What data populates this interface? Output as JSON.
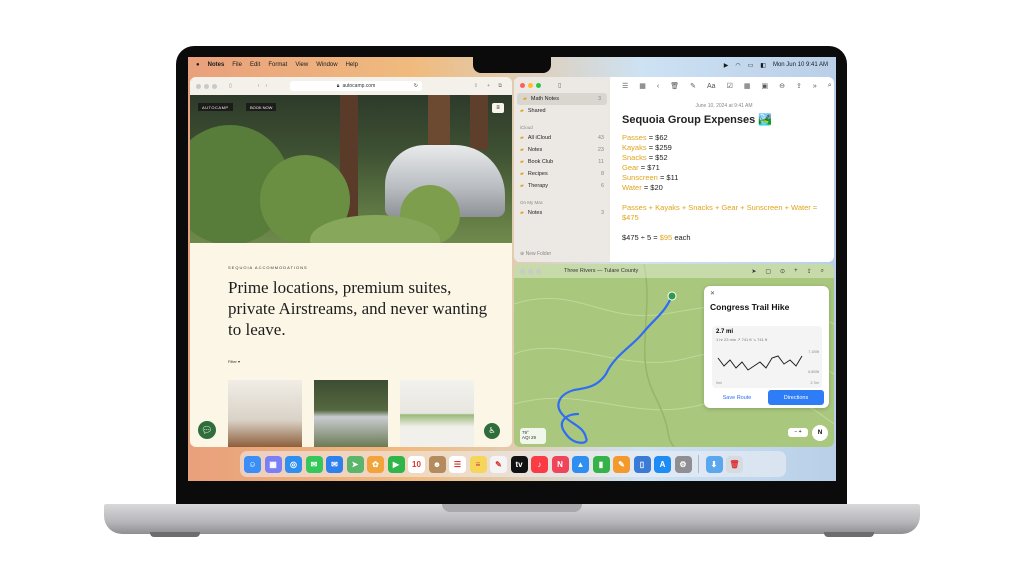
{
  "menubar": {
    "app": "Notes",
    "items": [
      "File",
      "Edit",
      "Format",
      "View",
      "Window",
      "Help"
    ],
    "clock": "Mon Jun 10  9:41 AM"
  },
  "safari": {
    "url": "autocamp.com",
    "brand": "AUTOCAMP",
    "book_now": "BOOK NOW",
    "kicker": "SEQUOIA ACCOMMODATIONS",
    "headline": "Prime locations, premium suites, private Airstreams, and never wanting to leave.",
    "filter": "Filter"
  },
  "notes": {
    "sidebar": [
      {
        "label": "Math Notes",
        "count": "3",
        "selected": true
      },
      {
        "label": "Shared",
        "count": "",
        "selected": false
      }
    ],
    "icloud_header": "iCloud",
    "folders": [
      {
        "label": "All iCloud",
        "count": "43"
      },
      {
        "label": "Notes",
        "count": "23"
      },
      {
        "label": "Book Club",
        "count": "11"
      },
      {
        "label": "Recipes",
        "count": "8"
      },
      {
        "label": "Therapy",
        "count": "6"
      }
    ],
    "onmymac_header": "On My Mac",
    "mac_folders": [
      {
        "label": "Notes",
        "count": "3"
      }
    ],
    "new_folder": "New Folder",
    "date": "June 10, 2024 at 9:41 AM",
    "title": "Sequoia Group Expenses 🏞️",
    "lines": [
      {
        "name": "Passes",
        "value": "= $62"
      },
      {
        "name": "Kayaks",
        "value": "= $259"
      },
      {
        "name": "Snacks",
        "value": "= $52"
      },
      {
        "name": "Gear",
        "value": "= $71"
      },
      {
        "name": "Sunscreen",
        "value": "= $11"
      },
      {
        "name": "Water",
        "value": "= $20"
      }
    ],
    "sum_line": "Passes + Kayaks + Snacks + Gear + Sunscreen + Water",
    "sum_result": "= $475",
    "split_expr": "$475 ÷ 5 =",
    "split_result": "$95",
    "split_suffix": "each"
  },
  "maps": {
    "title": "Three Rivers — Tulare County",
    "card_title": "Congress Trail Hike",
    "close": "✕",
    "distance": "2.7 mi",
    "meta": "1 hr 23 min  ↗ 741 ft  ↘ 741 ft",
    "y_top": "7,100ft",
    "y_bottom": "6,800ft",
    "x_left": "0mi",
    "x_right": "2.7mi",
    "save_route": "Save Route",
    "directions": "Directions",
    "weather_temp": "79°",
    "weather_aqi": "AQI 29",
    "compass": "N"
  },
  "dock": [
    {
      "name": "finder-icon",
      "glyph": "☺",
      "color": "#3a8ef6"
    },
    {
      "name": "launchpad-icon",
      "glyph": "▦",
      "color": "#7b7ff6"
    },
    {
      "name": "safari-icon",
      "glyph": "◎",
      "color": "#2f8ff0"
    },
    {
      "name": "messages-icon",
      "glyph": "✉",
      "color": "#34c759"
    },
    {
      "name": "mail-icon",
      "glyph": "✉",
      "color": "#2f80ed"
    },
    {
      "name": "maps-icon",
      "glyph": "➤",
      "color": "#5bb56b"
    },
    {
      "name": "photos-icon",
      "glyph": "✿",
      "color": "#f2a33a"
    },
    {
      "name": "facetime-icon",
      "glyph": "▶",
      "color": "#2fb54a"
    },
    {
      "name": "calendar-icon",
      "glyph": "10",
      "color": "#ffffff"
    },
    {
      "name": "contacts-icon",
      "glyph": "☻",
      "color": "#b38b5d"
    },
    {
      "name": "reminders-icon",
      "glyph": "☰",
      "color": "#ffffff"
    },
    {
      "name": "notes-icon",
      "glyph": "≡",
      "color": "#f5d55a"
    },
    {
      "name": "freeform-icon",
      "glyph": "✎",
      "color": "#f4f4f4"
    },
    {
      "name": "tv-icon",
      "glyph": "tv",
      "color": "#111111"
    },
    {
      "name": "music-icon",
      "glyph": "♪",
      "color": "#fc3c44"
    },
    {
      "name": "news-icon",
      "glyph": "N",
      "color": "#f0445a"
    },
    {
      "name": "keynote-icon",
      "glyph": "▲",
      "color": "#2f8ff0"
    },
    {
      "name": "numbers-icon",
      "glyph": "▮",
      "color": "#35b34a"
    },
    {
      "name": "pages-icon",
      "glyph": "✎",
      "color": "#f49a2c"
    },
    {
      "name": "iphone-mirroring-icon",
      "glyph": "▯",
      "color": "#3a7bd5"
    },
    {
      "name": "app-store-icon",
      "glyph": "A",
      "color": "#1f8cf5"
    },
    {
      "name": "settings-icon",
      "glyph": "⚙",
      "color": "#8e8e93"
    },
    {
      "name": "downloads-icon",
      "glyph": "⬇",
      "color": "#5aa7f0"
    },
    {
      "name": "trash-icon",
      "glyph": "🗑",
      "color": "#d6dbe2"
    }
  ]
}
